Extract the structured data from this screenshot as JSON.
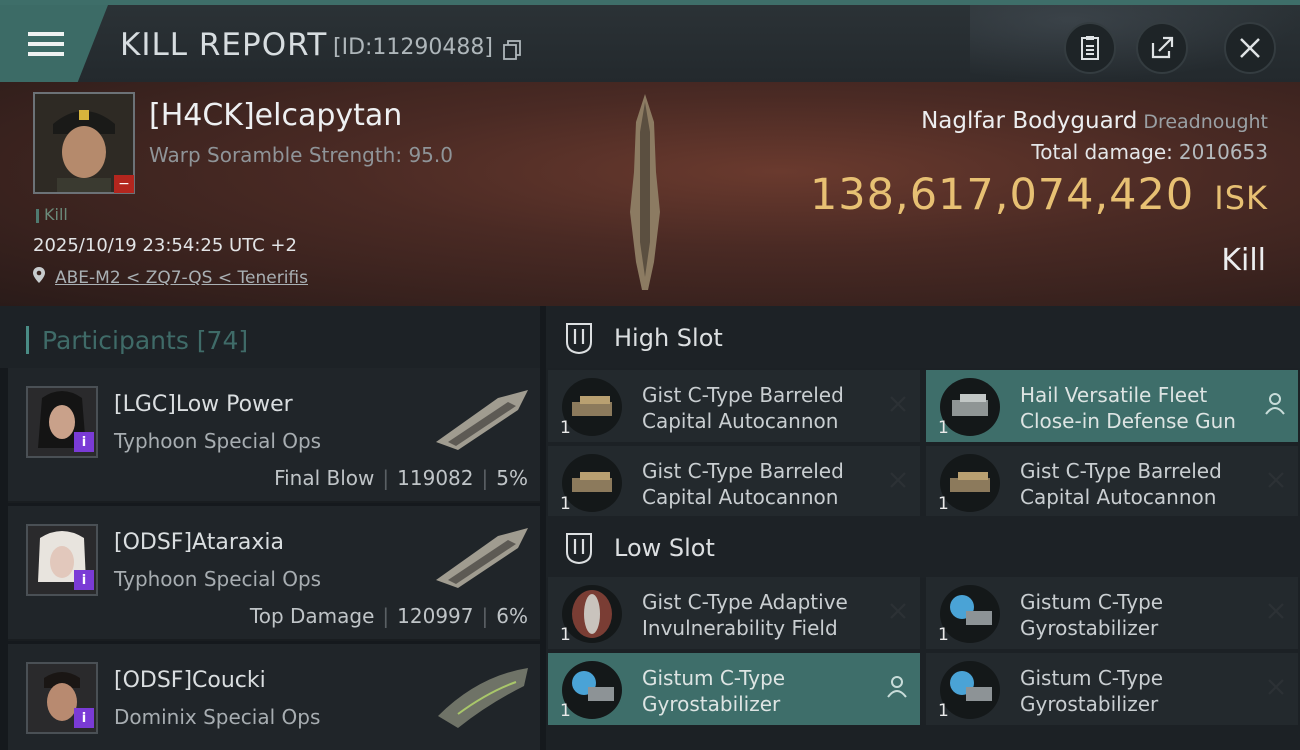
{
  "header": {
    "title": "KILL REPORT",
    "report_id": "[ID:11290488]"
  },
  "victim": {
    "name": "[H4CK]elcapytan",
    "scramble": "Warp Soramble Strength: 95.0",
    "kill_tag": "Kill",
    "datetime": "2025/10/19 23:54:25 UTC +2",
    "location": "ABE-M2 < ZQ7-QS < Tenerifis"
  },
  "ship": {
    "name": "Naglfar Bodyguard",
    "class": "Dreadnought",
    "total_damage_label": "Total damage:",
    "total_damage": "2010653",
    "isk_value": "138,617,074,420",
    "isk_unit": "ISK",
    "result": "Kill"
  },
  "participants": {
    "title": "Participants [74]",
    "items": [
      {
        "name": "[LGC]Low Power",
        "ship": "Typhoon Special Ops",
        "label": "Final Blow",
        "damage": "119082",
        "percent": "5%"
      },
      {
        "name": "[ODSF]Ataraxia",
        "ship": "Typhoon Special Ops",
        "label": "Top Damage",
        "damage": "120997",
        "percent": "6%"
      },
      {
        "name": "[ODSF]Coucki",
        "ship": "Dominix Special Ops",
        "label": "",
        "damage": "",
        "percent": ""
      }
    ]
  },
  "fitting": {
    "high_slot_title": "High Slot",
    "low_slot_title": "Low Slot",
    "high": [
      {
        "name": "Gist C-Type Barreled Capital Autocannon",
        "qty": "1",
        "status": "destroyed"
      },
      {
        "name": "Hail Versatile Fleet Close-in Defense Gun",
        "qty": "1",
        "status": "dropped"
      },
      {
        "name": "Gist C-Type Barreled Capital Autocannon",
        "qty": "1",
        "status": "destroyed"
      },
      {
        "name": "Gist C-Type Barreled Capital Autocannon",
        "qty": "1",
        "status": "destroyed"
      }
    ],
    "low": [
      {
        "name": "Gist C-Type Adaptive Invulnerability Field",
        "qty": "1",
        "status": "destroyed"
      },
      {
        "name": "Gistum C-Type Gyrostabilizer",
        "qty": "1",
        "status": "destroyed"
      },
      {
        "name": "Gistum C-Type Gyrostabilizer",
        "qty": "1",
        "status": "dropped"
      },
      {
        "name": "Gistum C-Type Gyrostabilizer",
        "qty": "1",
        "status": "destroyed"
      }
    ]
  },
  "colors": {
    "accent": "#3e6e6a",
    "isk": "#e7c073",
    "badge": "#7a3bd6",
    "minus_badge": "#b3261e"
  },
  "icons": [
    "menu-icon",
    "copy-icon",
    "clipboard-icon",
    "share-icon",
    "close-icon",
    "location-pin-icon",
    "slot-icon",
    "destroyed-x-icon",
    "dropped-person-icon"
  ]
}
